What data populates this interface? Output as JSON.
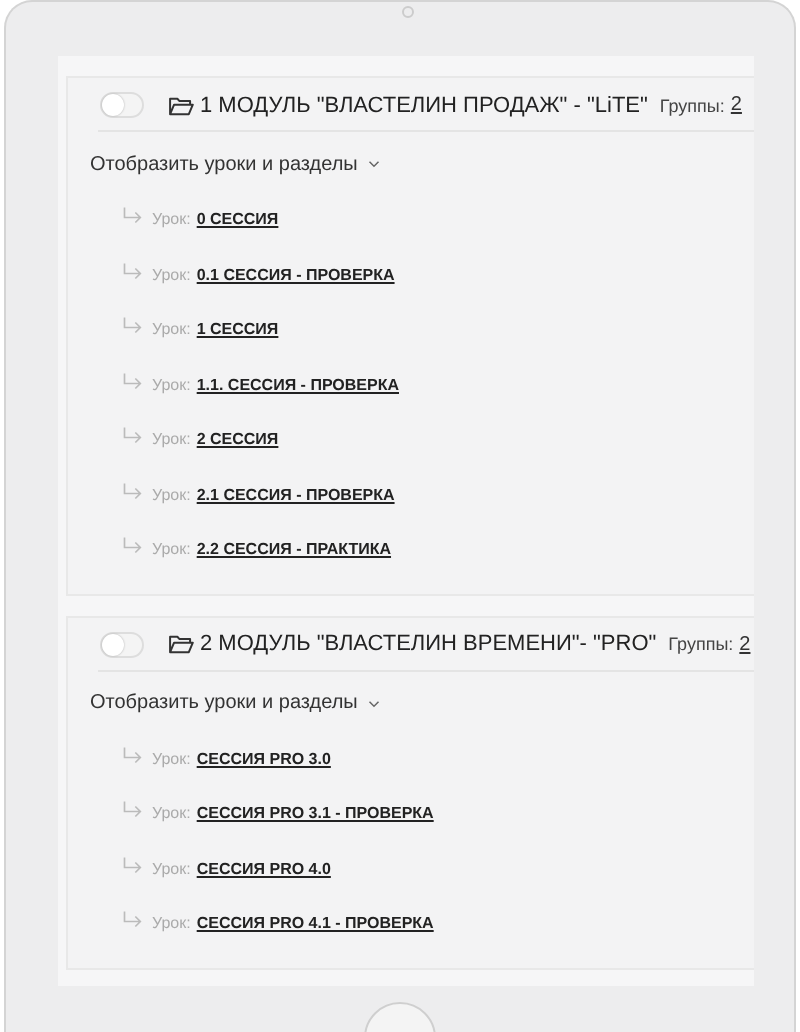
{
  "modules": [
    {
      "enabled": false,
      "title": "1 МОДУЛЬ \"ВЛАСТЕЛИН ПРОДАЖ\" - \"LiTE\"",
      "groups_label": "Группы:",
      "groups_count": "2",
      "expander": "Отобразить уроки и разделы",
      "expanded": true,
      "lessons": [
        {
          "prefix": "Урок:",
          "name": "0 СЕССИЯ"
        },
        {
          "prefix": "Урок:",
          "name": "0.1 СЕССИЯ - ПРОВЕРКА"
        },
        {
          "prefix": "Урок:",
          "name": "1 СЕССИЯ"
        },
        {
          "prefix": "Урок:",
          "name": "1.1. СЕССИЯ - ПРОВЕРКА"
        },
        {
          "prefix": "Урок:",
          "name": "2 СЕССИЯ"
        },
        {
          "prefix": "Урок:",
          "name": "2.1 СЕССИЯ - ПРОВЕРКА"
        },
        {
          "prefix": "Урок:",
          "name": "2.2 СЕССИЯ - ПРАКТИКА"
        }
      ]
    },
    {
      "enabled": false,
      "title": "2 МОДУЛЬ \"ВЛАСТЕЛИН ВРЕМЕНИ\"- \"PRO\"",
      "groups_label": "Группы:",
      "groups_count": "2",
      "expander": "Отобразить уроки и разделы",
      "expanded": true,
      "lessons": [
        {
          "prefix": "Урок:",
          "name": "СЕССИЯ PRO 3.0"
        },
        {
          "prefix": "Урок:",
          "name": "СЕССИЯ PRO 3.1 - ПРОВЕРКА"
        },
        {
          "prefix": "Урок:",
          "name": "СЕССИЯ PRO 4.0"
        },
        {
          "prefix": "Урок:",
          "name": "СЕССИЯ PRO 4.1 - ПРОВЕРКА"
        }
      ]
    }
  ]
}
